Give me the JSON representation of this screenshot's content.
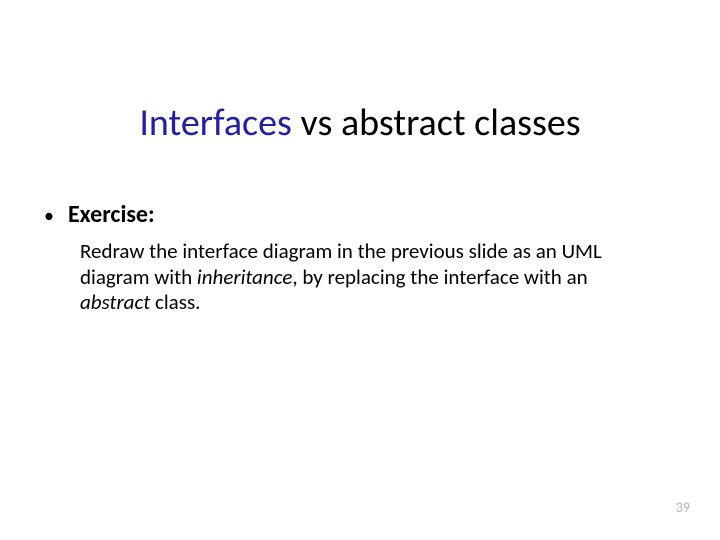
{
  "title": {
    "word1": "Interfaces",
    "word2": "vs",
    "word3": "abstract",
    "word4": "classes"
  },
  "bullet": {
    "marker": "•",
    "label": "Exercise:"
  },
  "body": {
    "t1": "Redraw the interface diagram in the previous slide as an UML diagram with ",
    "i1": "inheritance",
    "t2": ", by replacing the interface with an ",
    "i2": "abstract",
    "t3": " class."
  },
  "page_number": "39"
}
